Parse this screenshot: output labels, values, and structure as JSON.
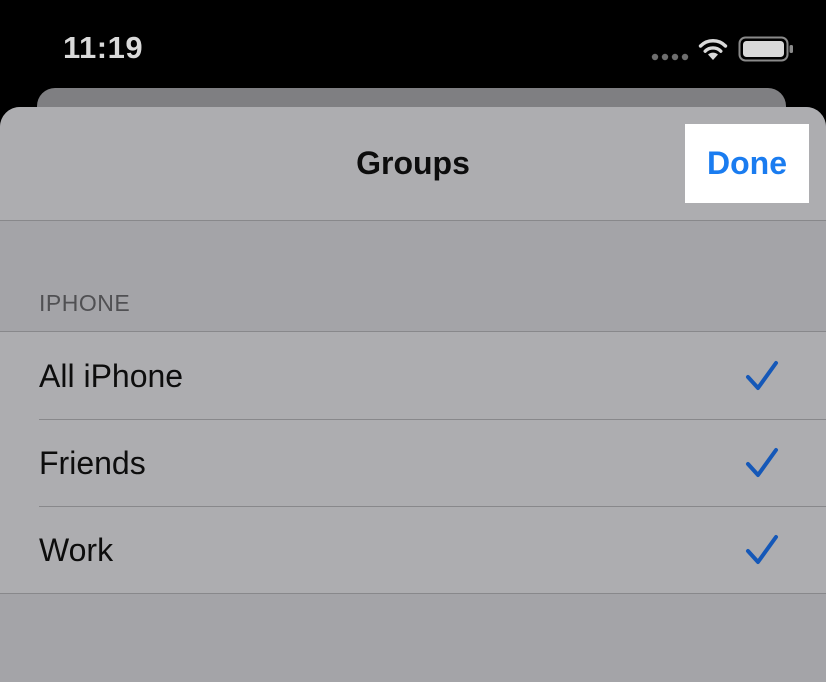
{
  "status_bar": {
    "time": "11:19",
    "icons": [
      "cellular-signal-icon",
      "wifi-icon",
      "battery-icon"
    ]
  },
  "nav": {
    "title": "Groups",
    "done_label": "Done"
  },
  "section": {
    "header": "IPHONE"
  },
  "groups": [
    {
      "label": "All iPhone",
      "checked": true
    },
    {
      "label": "Friends",
      "checked": true
    },
    {
      "label": "Work",
      "checked": true
    }
  ],
  "colors": {
    "accent": "#1a7cf0",
    "checkmark": "#1558b8",
    "sheet_background": "#a4a4a8",
    "row_background": "#adadb0"
  }
}
